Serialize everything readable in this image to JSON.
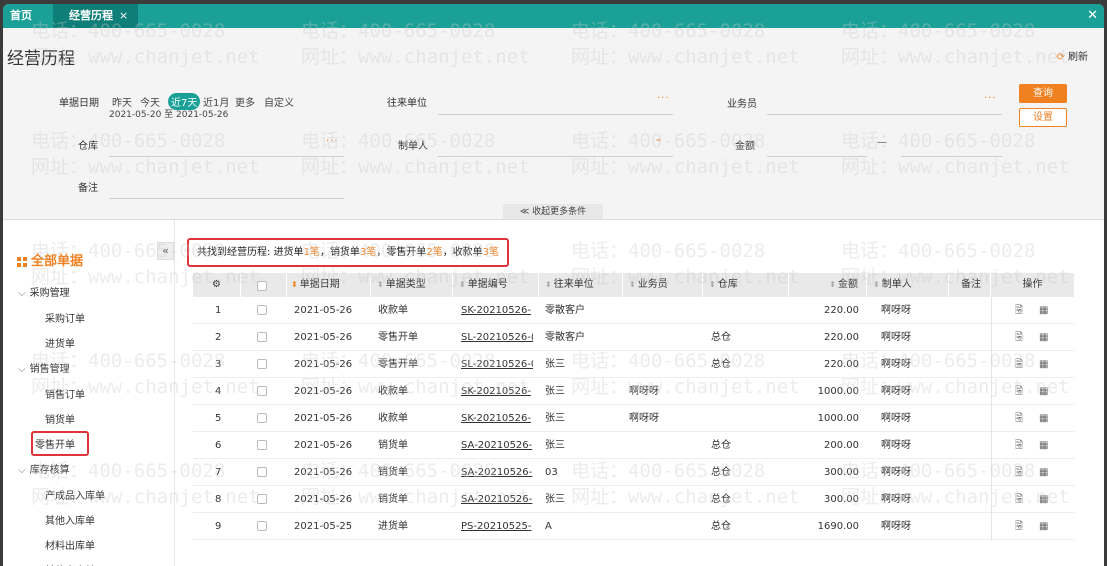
{
  "tabs": {
    "home": "首页",
    "active": "经营历程",
    "tab_close": "×",
    "window_close": "✕"
  },
  "page": {
    "title": "经营历程",
    "refresh": "刷新",
    "refresh_icon": "⟳"
  },
  "watermark": {
    "phone": "电话：400-665-0028",
    "site": "网址：www.chanjet.net"
  },
  "filters": {
    "date_label": "单据日期",
    "date_options": [
      "昨天",
      "今天",
      "近7天",
      "近1月",
      "更多",
      "自定义"
    ],
    "date_active_index": 2,
    "date_range": "2021-05-20 至 2021-05-26",
    "partner_label": "往来单位",
    "salesman_label": "业务员",
    "warehouse_label": "仓库",
    "maker_label": "制单人",
    "amount_label": "金额",
    "amount_sep": "—",
    "note_label": "备注",
    "more_dots": "···",
    "chevron": "⌄",
    "query_button": "查询",
    "setting_button": "设置",
    "collapse_label": "≪ 收起更多条件"
  },
  "sidebar": {
    "collapse_icon": "«",
    "head": "全部单据",
    "groups": [
      {
        "label": "采购管理",
        "items": [
          "采购订单",
          "进货单"
        ]
      },
      {
        "label": "销售管理",
        "items": [
          "销售订单",
          "销货单",
          "零售开单"
        ]
      },
      {
        "label": "库存核算",
        "items": [
          "产成品入库单",
          "其他入库单",
          "材料出库单",
          "其他出库单"
        ]
      }
    ],
    "expand_icon": "⌵",
    "selected": "零售开单"
  },
  "summary": {
    "prefix": "共找到经营历程: ",
    "parts": [
      {
        "label": "进货单",
        "count": "1笔",
        "sep": "，"
      },
      {
        "label": "销货单",
        "count": "3笔",
        "sep": "，"
      },
      {
        "label": "零售开单",
        "count": "2笔",
        "sep": "，"
      },
      {
        "label": "收款单",
        "count": "3笔",
        "sep": ""
      }
    ]
  },
  "table": {
    "headers": {
      "settings_icon": "⚙",
      "date": "单据日期",
      "type": "单据类型",
      "number": "单据编号",
      "partner": "往来单位",
      "salesman": "业务员",
      "warehouse": "仓库",
      "amount": "金额",
      "maker": "制单人",
      "note": "备注",
      "operation": "操作"
    },
    "sort_icon": "⬍",
    "rows": [
      {
        "idx": "1",
        "date": "2021-05-26",
        "type": "收款单",
        "number": "SK-20210526-",
        "partner": "零散客户",
        "salesman": "",
        "warehouse": "",
        "amount": "220.00",
        "maker": "啊呀呀",
        "note": ""
      },
      {
        "idx": "2",
        "date": "2021-05-26",
        "type": "零售开单",
        "number": "SL-20210526-(",
        "partner": "零散客户",
        "salesman": "",
        "warehouse": "总仓",
        "amount": "220.00",
        "maker": "啊呀呀",
        "note": ""
      },
      {
        "idx": "3",
        "date": "2021-05-26",
        "type": "零售开单",
        "number": "SL-20210526-0",
        "partner": "张三",
        "salesman": "",
        "warehouse": "总仓",
        "amount": "220.00",
        "maker": "啊呀呀",
        "note": ""
      },
      {
        "idx": "4",
        "date": "2021-05-26",
        "type": "收款单",
        "number": "SK-20210526-",
        "partner": "张三",
        "salesman": "啊呀呀",
        "warehouse": "",
        "amount": "1000.00",
        "maker": "啊呀呀",
        "note": ""
      },
      {
        "idx": "5",
        "date": "2021-05-26",
        "type": "收款单",
        "number": "SK-20210526-",
        "partner": "张三",
        "salesman": "啊呀呀",
        "warehouse": "",
        "amount": "1000.00",
        "maker": "啊呀呀",
        "note": ""
      },
      {
        "idx": "6",
        "date": "2021-05-26",
        "type": "销货单",
        "number": "SA-20210526-",
        "partner": "张三",
        "salesman": "",
        "warehouse": "总仓",
        "amount": "200.00",
        "maker": "啊呀呀",
        "note": ""
      },
      {
        "idx": "7",
        "date": "2021-05-26",
        "type": "销货单",
        "number": "SA-20210526-",
        "partner": "03",
        "salesman": "",
        "warehouse": "总仓",
        "amount": "300.00",
        "maker": "啊呀呀",
        "note": ""
      },
      {
        "idx": "8",
        "date": "2021-05-26",
        "type": "销货单",
        "number": "SA-20210526-",
        "partner": "张三",
        "salesman": "",
        "warehouse": "总仓",
        "amount": "300.00",
        "maker": "啊呀呀",
        "note": ""
      },
      {
        "idx": "9",
        "date": "2021-05-25",
        "type": "进货单",
        "number": "PS-20210525-",
        "partner": "A",
        "salesman": "",
        "warehouse": "总仓",
        "amount": "1690.00",
        "maker": "啊呀呀",
        "note": ""
      }
    ],
    "row_actions": {
      "view_icon": "🗟",
      "qr_icon": "▦"
    }
  },
  "colors": {
    "teal": "#1aa097",
    "orange": "#f08020",
    "highlight_red": "#e0343c"
  }
}
